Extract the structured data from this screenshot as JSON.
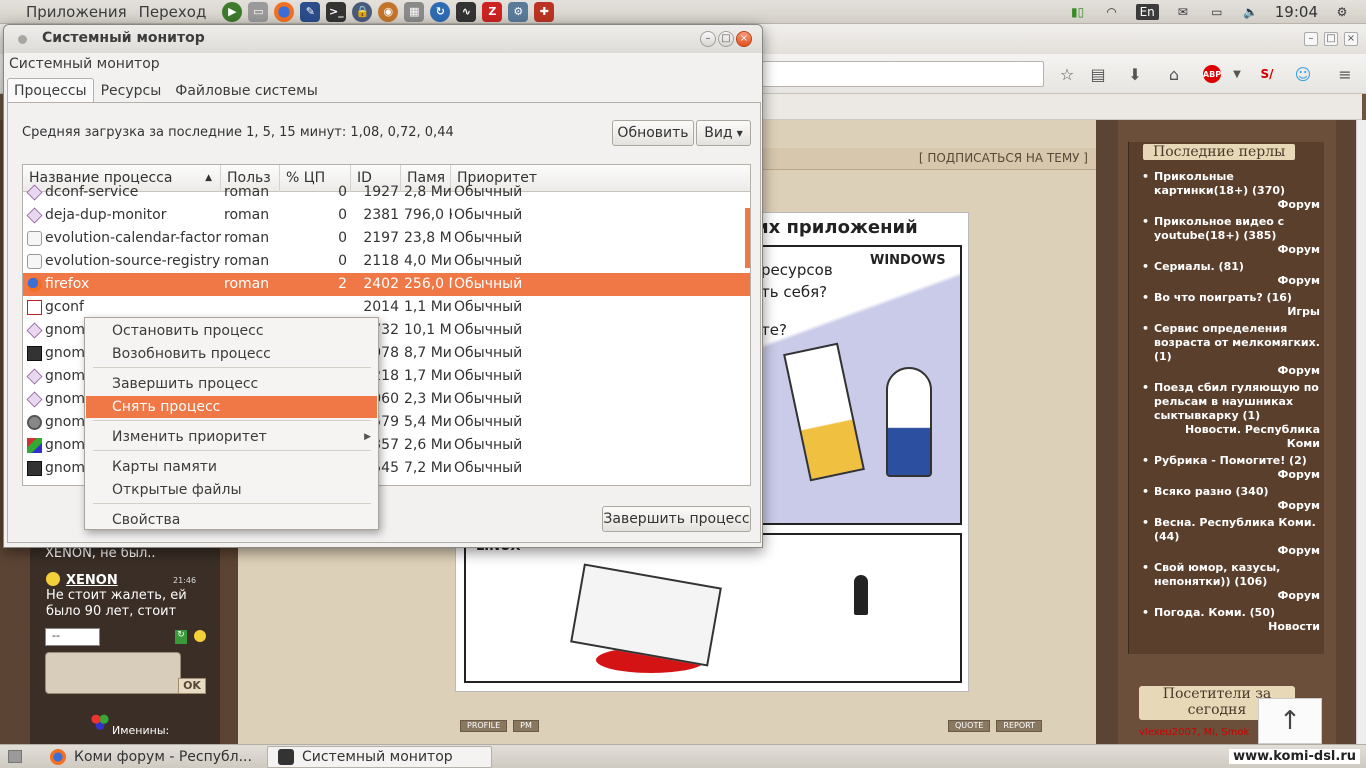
{
  "top_panel": {
    "menu_apps": "Приложения",
    "menu_go": "Переход",
    "lang": "En",
    "clock": "19:04"
  },
  "browser": {
    "subscribe": "[ ПОДПИСАТЬСЯ НА ТЕМУ ]",
    "comic": {
      "title_fragment": "их приложений",
      "windows_label": "WINDOWS",
      "linux_label": "LINUX",
      "text_line1": "ресурсов",
      "text_line2": "ть себя?",
      "text_line3": "те?"
    },
    "post_buttons": [
      "PROFILE",
      "PM",
      "QUOTE",
      "REPORT"
    ],
    "chat": [
      {
        "text": "XENON, не был.."
      },
      {
        "name": "XENON",
        "time": "21:46",
        "text": "Не стоит жалеть, ей было 90 лет, стоит"
      }
    ],
    "chat_select": "--",
    "chat_ok": "OK",
    "namedays": "Именины:",
    "perls_title": "Последние перлы",
    "perls": [
      {
        "title": "Прикольные картинки(18+) (370)",
        "cat": "Форум"
      },
      {
        "title": "Прикольное видео с youtube(18+) (385)",
        "cat": "Форум"
      },
      {
        "title": "Сериалы. (81)",
        "cat": "Форум"
      },
      {
        "title": "Во что поиграть? (16)",
        "cat": "Игры"
      },
      {
        "title": "Сервис определения возраста от мелкомягких. (1)",
        "cat": "Форум"
      },
      {
        "title": "Поезд сбил гуляющую по рельсам в наушниках сыктывкарку (1)",
        "cat": "Новости. Республика Коми"
      },
      {
        "title": "Рубрика - Помогите! (2)",
        "cat": "Форум"
      },
      {
        "title": "Всяко разно (340)",
        "cat": "Форум"
      },
      {
        "title": "Весна. Республика Коми. (44)",
        "cat": "Форум"
      },
      {
        "title": "Свой юмор, казусы, непонятки)) (106)",
        "cat": "Форум"
      },
      {
        "title": "Погода. Коми. (50)",
        "cat": "Новости"
      }
    ],
    "visitors_title": "Посетители за сегодня",
    "visitors_names": "vlexeu2007, Mi, Smok"
  },
  "taskbar": {
    "tasks": [
      {
        "label": "Коми форум - Республ..."
      },
      {
        "label": "Системный монитор"
      }
    ],
    "watermark": "www.komi-dsl.ru"
  },
  "sysmon": {
    "title": "Системный монитор",
    "menu": "Системный монитор",
    "tabs": [
      "Процессы",
      "Ресурсы",
      "Файловые системы"
    ],
    "load_avg": "Средняя загрузка за последние 1, 5, 15 минут: 1,08, 0,72, 0,44",
    "refresh_btn": "Обновить",
    "view_btn": "Вид",
    "columns": [
      "Название процесса",
      "Польз",
      "% ЦП",
      "ID",
      "Памя",
      "Приоритет"
    ],
    "rows": [
      {
        "name": "dconf-service",
        "user": "roman",
        "cpu": "0",
        "pid": "1927",
        "mem": "2,8 Ми",
        "prio": "Обычный",
        "icon": "diamond"
      },
      {
        "name": "deja-dup-monitor",
        "user": "roman",
        "cpu": "0",
        "pid": "2381",
        "mem": "796,0 К",
        "prio": "Обычный",
        "icon": "diamond"
      },
      {
        "name": "evolution-calendar-factory",
        "user": "roman",
        "cpu": "0",
        "pid": "2197",
        "mem": "23,8 Ми",
        "prio": "Обычный",
        "icon": "doc"
      },
      {
        "name": "evolution-source-registry",
        "user": "roman",
        "cpu": "0",
        "pid": "2118",
        "mem": "4,0 Ми",
        "prio": "Обычный",
        "icon": "doc"
      },
      {
        "name": "firefox",
        "user": "roman",
        "cpu": "2",
        "pid": "2402",
        "mem": "256,0 М",
        "prio": "Обычный",
        "icon": "fox",
        "selected": true
      },
      {
        "name": "gconf",
        "user": "",
        "cpu": "",
        "pid": "2014",
        "mem": "1,1 Ми",
        "prio": "Обычный",
        "icon": "gconf"
      },
      {
        "name": "gnome",
        "user": "",
        "cpu": "",
        "pid": "1732",
        "mem": "10,1 Ми",
        "prio": "Обычный",
        "icon": "diamond"
      },
      {
        "name": "gnome",
        "user": "",
        "cpu": "",
        "pid": "1978",
        "mem": "8,7 Ми",
        "prio": "Обычный",
        "icon": "term"
      },
      {
        "name": "gnome",
        "user": "",
        "cpu": "",
        "pid": "2218",
        "mem": "1,7 Ми",
        "prio": "Обычный",
        "icon": "diamond"
      },
      {
        "name": "gnome",
        "user": "",
        "cpu": "",
        "pid": "2060",
        "mem": "2,3 Ми",
        "prio": "Обычный",
        "icon": "diamond"
      },
      {
        "name": "gnome",
        "user": "",
        "cpu": "",
        "pid": "1579",
        "mem": "5,4 Ми",
        "prio": "Обычный",
        "icon": "gear"
      },
      {
        "name": "gnome",
        "user": "",
        "cpu": "",
        "pid": "2357",
        "mem": "2,6 Ми",
        "prio": "Обычный",
        "icon": "colors"
      },
      {
        "name": "gnome",
        "user": "",
        "cpu": "",
        "pid": "1545",
        "mem": "7,2 Ми",
        "prio": "Обычный",
        "icon": "term"
      }
    ],
    "end_process_btn": "Завершить процесс",
    "context_menu": [
      {
        "label": "Остановить процесс"
      },
      {
        "label": "Возобновить процесс"
      },
      {
        "label": "Завершить процесс"
      },
      {
        "label": "Снять процесс",
        "highlighted": true
      },
      {
        "label": "Изменить приоритет",
        "submenu": true
      },
      {
        "label": "Карты памяти"
      },
      {
        "label": "Открытые файлы"
      },
      {
        "label": "Свойства"
      }
    ]
  }
}
